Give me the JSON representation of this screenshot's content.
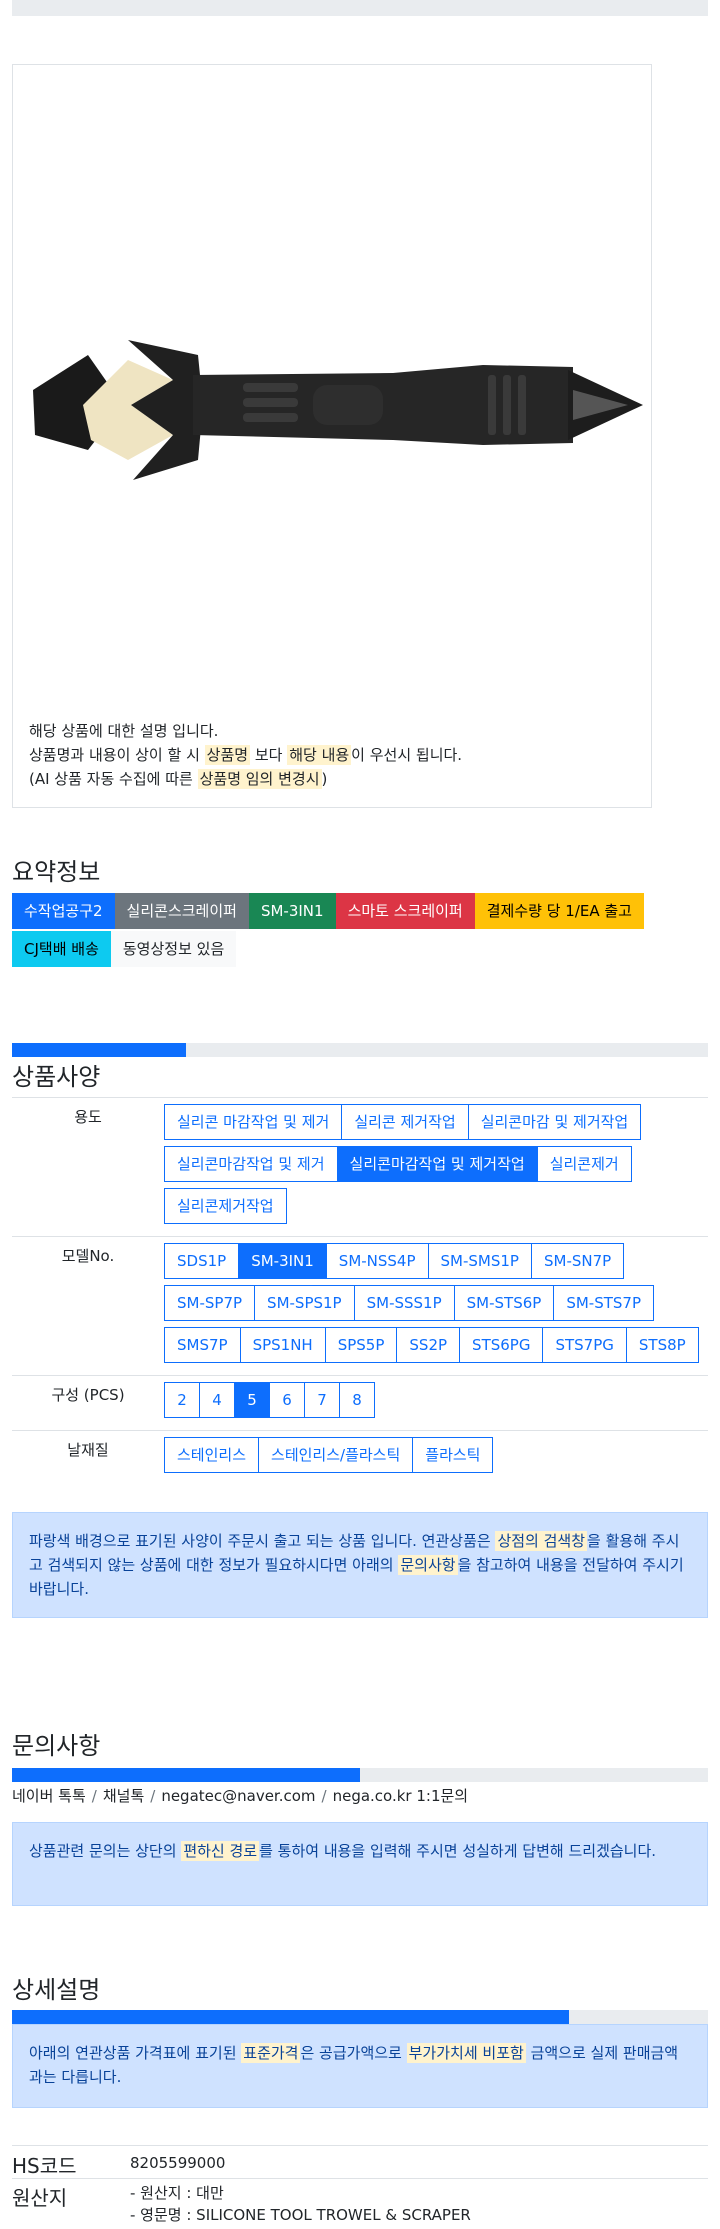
{
  "product_image": {
    "description_lines": [
      {
        "parts": [
          {
            "t": "해당 상품에 대한 설명 입니다."
          }
        ]
      },
      {
        "parts": [
          {
            "t": "상품명과 내용이 상이 할 시 "
          },
          {
            "t": "상품명",
            "hl": true
          },
          {
            "t": " 보다 "
          },
          {
            "t": "해당 내용",
            "hl": true
          },
          {
            "t": "이 우선시 됩니다."
          }
        ]
      },
      {
        "parts": [
          {
            "t": "(AI 상품 자동 수집에 따른 "
          },
          {
            "t": "상품명 임의 변경시",
            "hl": true
          },
          {
            "t": ")"
          }
        ]
      }
    ]
  },
  "summary": {
    "title": "요약정보",
    "badges": [
      {
        "label": "수작업공구2",
        "bg": "#0d6efd",
        "fg": "#ffffff"
      },
      {
        "label": "실리콘스크레이퍼",
        "bg": "#6c757d",
        "fg": "#ffffff"
      },
      {
        "label": "SM-3IN1",
        "bg": "#198754",
        "fg": "#ffffff"
      },
      {
        "label": "스마토 스크레이퍼",
        "bg": "#dc3545",
        "fg": "#ffffff"
      },
      {
        "label": "결제수량 당 1/EA 출고",
        "bg": "#ffc107",
        "fg": "#000000"
      },
      {
        "label": "CJ택배 배송",
        "bg": "#0dcaf0",
        "fg": "#000000"
      },
      {
        "label": "동영상정보 있음",
        "bg": "#f8f9fa",
        "fg": "#212529"
      }
    ]
  },
  "spec": {
    "title": "상품사양",
    "progress": 0.25,
    "rows": [
      {
        "label": "용도",
        "options": [
          {
            "label": "실리콘 마감작업 및 제거"
          },
          {
            "label": "실리콘 제거작업"
          },
          {
            "label": "실리콘마감 및 제거작업"
          },
          {
            "label": "실리콘마감작업 및 제거"
          },
          {
            "label": "실리콘마감작업 및 제거작업",
            "active": true
          },
          {
            "label": "실리콘제거"
          },
          {
            "label": "실리콘제거작업"
          }
        ]
      },
      {
        "label": "모델No.",
        "options": [
          {
            "label": "SDS1P"
          },
          {
            "label": "SM-3IN1",
            "active": true
          },
          {
            "label": "SM-NSS4P"
          },
          {
            "label": "SM-SMS1P"
          },
          {
            "label": "SM-SN7P"
          },
          {
            "label": "SM-SP7P"
          },
          {
            "label": "SM-SPS1P"
          },
          {
            "label": "SM-SSS1P"
          },
          {
            "label": "SM-STS6P"
          },
          {
            "label": "SM-STS7P"
          },
          {
            "label": "SMS7P"
          },
          {
            "label": "SPS1NH"
          },
          {
            "label": "SPS5P"
          },
          {
            "label": "SS2P"
          },
          {
            "label": "STS6PG"
          },
          {
            "label": "STS7PG"
          },
          {
            "label": "STS8P"
          }
        ]
      },
      {
        "label": "구성 (PCS)",
        "square": true,
        "options": [
          {
            "label": "2"
          },
          {
            "label": "4"
          },
          {
            "label": "5",
            "active": true
          },
          {
            "label": "6"
          },
          {
            "label": "7"
          },
          {
            "label": "8"
          }
        ]
      },
      {
        "label": "날재질",
        "options": [
          {
            "label": "스테인리스"
          },
          {
            "label": "스테인리스/플라스틱"
          },
          {
            "label": "플라스틱"
          }
        ]
      }
    ],
    "notice": [
      {
        "t": "파랑색 배경으로 표기된 사양이 주문시 출고 되는 상품 입니다. 연관상품은 "
      },
      {
        "t": "상점의 검색창",
        "hl": true
      },
      {
        "t": "을 활용해 주시고 검색되지 않는 상품에 대한 정보가 필요하시다면 아래의 "
      },
      {
        "t": "문의사항",
        "hl": true
      },
      {
        "t": "을 참고하여 내용을 전달하여 주시기 바랍니다."
      }
    ]
  },
  "inquiry": {
    "title": "문의사항",
    "progress": 0.5,
    "contacts": [
      "네이버 톡톡",
      "채널톡",
      "negatec@naver.com",
      "nega.co.kr 1:1문의"
    ],
    "notice": [
      {
        "t": "상품관련 문의는 상단의 "
      },
      {
        "t": "편하신 경로",
        "hl": true
      },
      {
        "t": "를 통하여 내용을 입력해 주시면 성실하게 답변해 드리겠습니다."
      }
    ]
  },
  "detail": {
    "title": "상세설명",
    "progress": 0.8,
    "notice": [
      {
        "t": "아래의 연관상품 가격표에 표기된 "
      },
      {
        "t": "표준가격",
        "hl": true
      },
      {
        "t": "은 공급가액으로 "
      },
      {
        "t": "부가가치세 비포함",
        "hl": true
      },
      {
        "t": " 금액으로 실제 판매금액과는 다릅니다."
      }
    ],
    "hs_code_label": "HS코드",
    "hs_code_value": "8205599000",
    "origin_label": "원산지",
    "origin_lines": [
      "- 원산지 : 대만",
      "- 영문명 : SILICONE TOOL TROWEL & SCRAPER"
    ]
  }
}
